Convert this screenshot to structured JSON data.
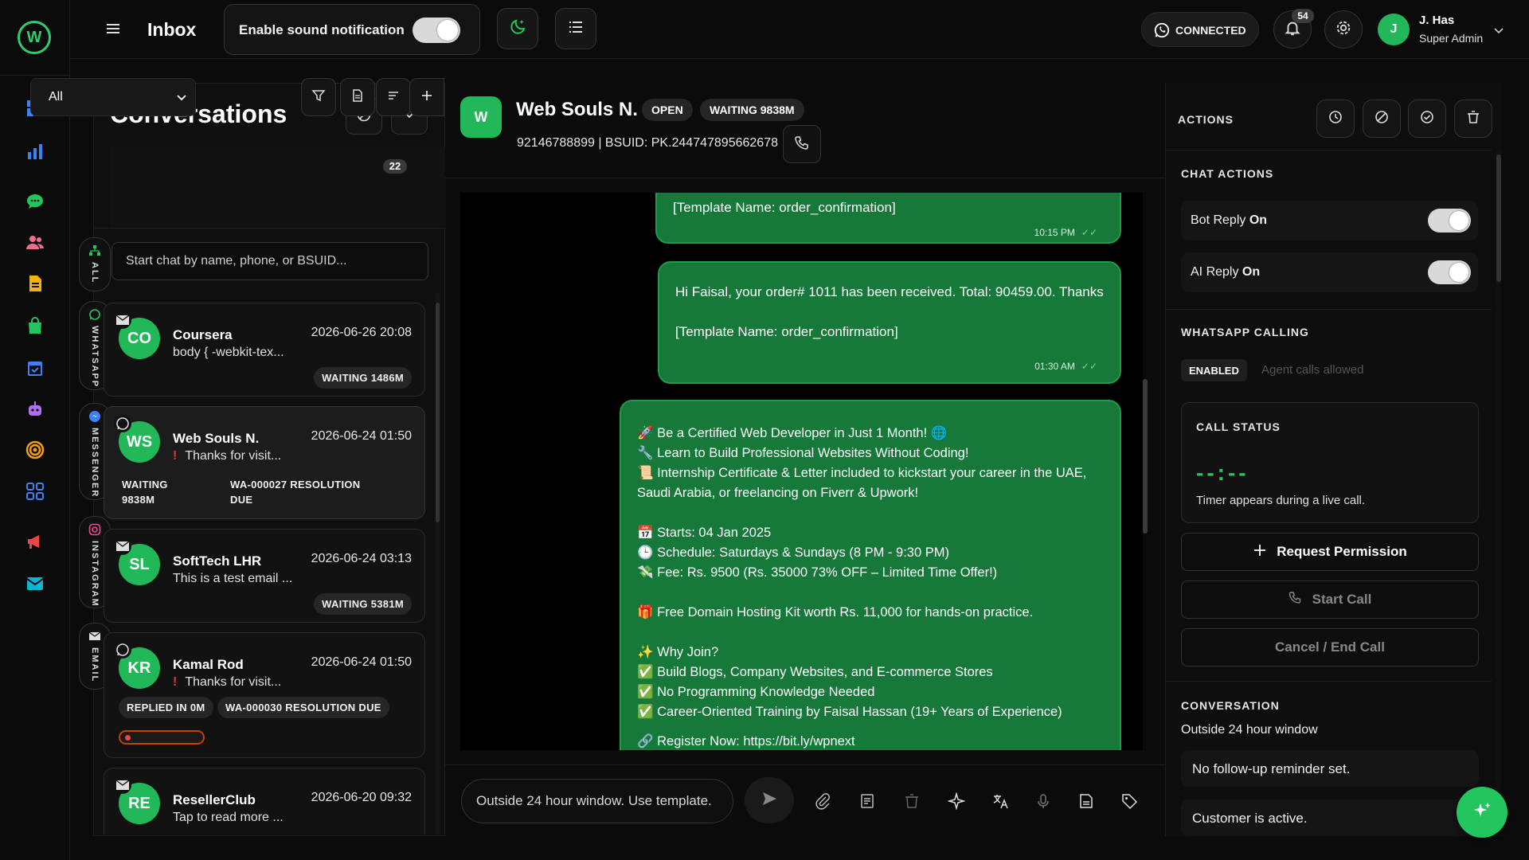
{
  "header": {
    "title": "Inbox",
    "sound_label": "Enable sound notification",
    "sound_enabled": true,
    "connection_status": "CONNECTED",
    "notification_count": "54",
    "user": {
      "initial": "J",
      "name": "J. Has",
      "role": "Super Admin"
    }
  },
  "conversations": {
    "title": "Conversations",
    "filter_value": "All",
    "count_badge": "22",
    "search_placeholder": "Start chat by name, phone, or BSUID...",
    "channel_tabs": [
      "ALL",
      "WHATSAPP",
      "MESSENGER",
      "INSTAGRAM",
      "EMAIL"
    ],
    "items": [
      {
        "initials": "CO",
        "name": "Coursera",
        "date": "2026-06-26 20:08",
        "preview": "body { -webkit-tex...",
        "source": "email-icon",
        "pills": [
          "WAITING 1486M"
        ],
        "alert": false
      },
      {
        "initials": "WS",
        "name": "Web Souls N.",
        "date": "2026-06-24 01:50",
        "preview": "Thanks for visit...",
        "source": "whatsapp-icon",
        "pills": [
          "WAITING 9838M",
          "WA-000027 RESOLUTION DUE"
        ],
        "alert": true
      },
      {
        "initials": "SL",
        "name": "SoftTech LHR",
        "date": "2026-06-24 03:13",
        "preview": "This is a test email ...",
        "source": "email-icon",
        "pills": [
          "WAITING 5381M"
        ],
        "alert": false
      },
      {
        "initials": "KR",
        "name": "Kamal Rod",
        "date": "2026-06-24 01:50",
        "preview": "Thanks for visit...",
        "source": "whatsapp-icon",
        "pills": [
          "REPLIED IN 0M",
          "WA-000030 RESOLUTION DUE"
        ],
        "alert": true
      },
      {
        "initials": "RE",
        "name": "ResellerClub",
        "date": "2026-06-20 09:32",
        "preview": "Tap to read more   ...",
        "source": "email-icon",
        "pills": [],
        "alert": false
      }
    ]
  },
  "chat": {
    "avatar": "W",
    "name": "Web Souls N.",
    "status": "OPEN",
    "waiting": "WAITING 9838M",
    "subtitle": "92146788899 | BSUID: PK.244747895662678",
    "messages": [
      {
        "lines": [
          "[Template Name: order_confirmation]"
        ],
        "time": "10:15 PM"
      },
      {
        "lines": [
          "Hi Faisal, your order# 1011 has been received. Total: 90459.00. Thanks",
          "",
          "[Template Name: order_confirmation]"
        ],
        "time": "01:30 AM"
      },
      {
        "lines": [
          "🚀 Be a Certified Web Developer in Just 1 Month! 🌐",
          "🔧 Learn to Build Professional Websites Without Coding!",
          "📜 Internship Certificate & Letter included to kickstart your career in the UAE, Saudi Arabia, or freelancing on Fiverr & Upwork!",
          "",
          "📅 Starts: 04 Jan 2025",
          "🕒 Schedule: Saturdays & Sundays (8 PM - 9:30 PM)",
          "💸 Fee: Rs. 9500 (Rs. 35000 73% OFF – Limited Time Offer!)",
          "",
          "🎁 Free Domain Hosting Kit worth Rs. 11,000 for hands-on practice.",
          "",
          "✨ Why Join?",
          "✅ Build Blogs, Company Websites, and E-commerce Stores",
          "✅ No Programming Knowledge Needed",
          "✅ Career-Oriented Training by Faisal Hassan (19+ Years of Experience)",
          "",
          "🔗 Register Now: https://bit.ly/wpnext"
        ],
        "time": ""
      }
    ],
    "composer_placeholder": "Outside 24 hour window. Use template."
  },
  "actions": {
    "title": "ACTIONS",
    "chat_actions_title": "CHAT ACTIONS",
    "bot_reply_label": "Bot Reply",
    "bot_reply_state": "On",
    "ai_reply_label": "AI Reply",
    "ai_reply_state": "On",
    "whatsapp_calling_title": "WHATSAPP CALLING",
    "calling_status": "ENABLED",
    "calling_note": "Agent calls allowed",
    "call_status_title": "CALL STATUS",
    "timer": "--:--",
    "timer_note": "Timer appears during a live call.",
    "request_permission": "Request Permission",
    "start_call": "Start Call",
    "cancel_call": "Cancel / End Call",
    "conversation_title": "CONVERSATION",
    "conversation_note": "Outside 24 hour window",
    "reminder": "No follow-up reminder set.",
    "customer_status": "Customer is active."
  },
  "colors": {
    "accent": "#22c55e",
    "bubble": "#16793a",
    "alert": "#e53935"
  }
}
